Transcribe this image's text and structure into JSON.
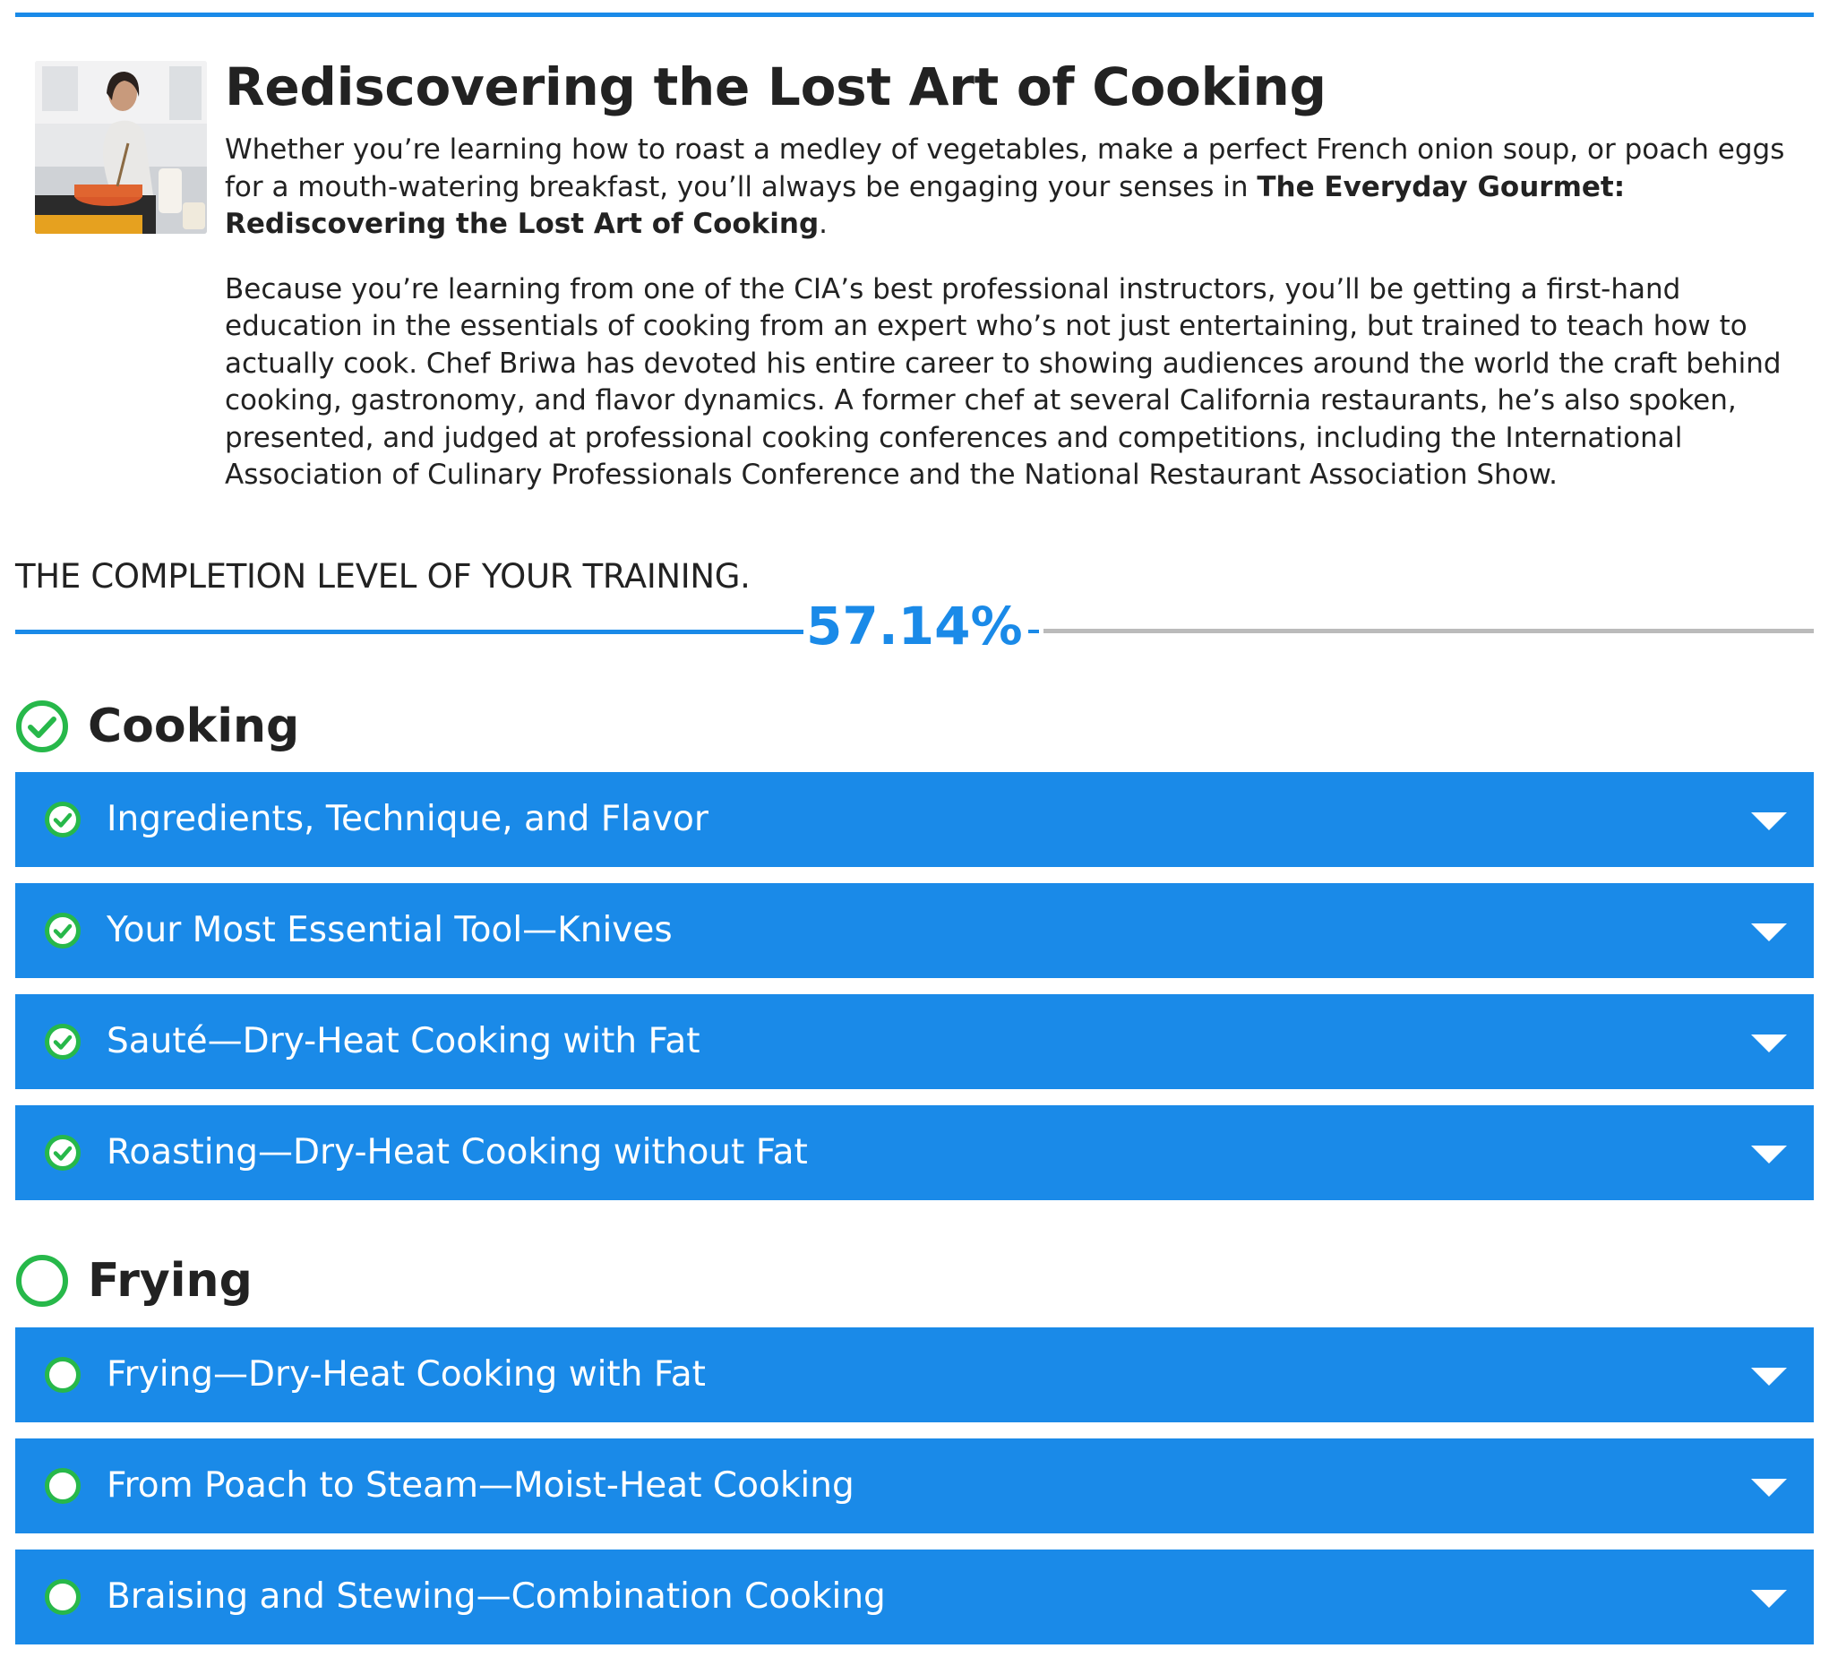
{
  "course": {
    "title": "Rediscovering the Lost Art of Cooking",
    "para1_start": "Whether you’re learning how to roast a medley of vegetables, make a perfect French onion soup, or poach eggs for a mouth-watering breakfast, you’ll always be engaging your senses in ",
    "para1_bold": "The Everyday Gourmet: Rediscovering the Lost Art of Cooking",
    "para1_end": ".",
    "para2": "Because you’re learning from one of the CIA’s best professional instructors, you’ll be getting a first-hand education in the essentials of cooking from an expert who’s not just entertaining, but trained to teach how to actually cook. Chef Briwa has devoted his entire career to showing audiences around the world the craft behind cooking, gastronomy, and flavor dynamics. A former chef at several California restaurants, he’s also spoken, presented, and judged at professional cooking conferences and competitions, including the International Association of Culinary Professionals Conference and the National Restaurant Association Show."
  },
  "progress": {
    "label": "THE COMPLETION LEVEL OF YOUR TRAINING.",
    "percent_text": "57.14%",
    "fraction": 0.5714
  },
  "sections": [
    {
      "title": "Cooking",
      "complete": true,
      "lessons": [
        {
          "label": "Ingredients, Technique, and Flavor",
          "complete": true
        },
        {
          "label": "Your Most Essential Tool—Knives",
          "complete": true
        },
        {
          "label": "Sauté—Dry-Heat Cooking with Fat",
          "complete": true
        },
        {
          "label": "Roasting—Dry-Heat Cooking without Fat",
          "complete": true
        }
      ]
    },
    {
      "title": "Frying",
      "complete": false,
      "lessons": [
        {
          "label": "Frying—Dry-Heat Cooking with Fat",
          "complete": false
        },
        {
          "label": "From Poach to Steam—Moist-Heat Cooking",
          "complete": false
        },
        {
          "label": "Braising and Stewing—Combination Cooking",
          "complete": false
        }
      ]
    }
  ],
  "colors": {
    "accent": "#1a8ae8",
    "success": "#27b84a",
    "track": "#bbbbbb"
  },
  "icons": {
    "section_complete": "check-circle-icon",
    "section_incomplete": "empty-circle-icon",
    "lesson_expand": "caret-down-icon"
  }
}
